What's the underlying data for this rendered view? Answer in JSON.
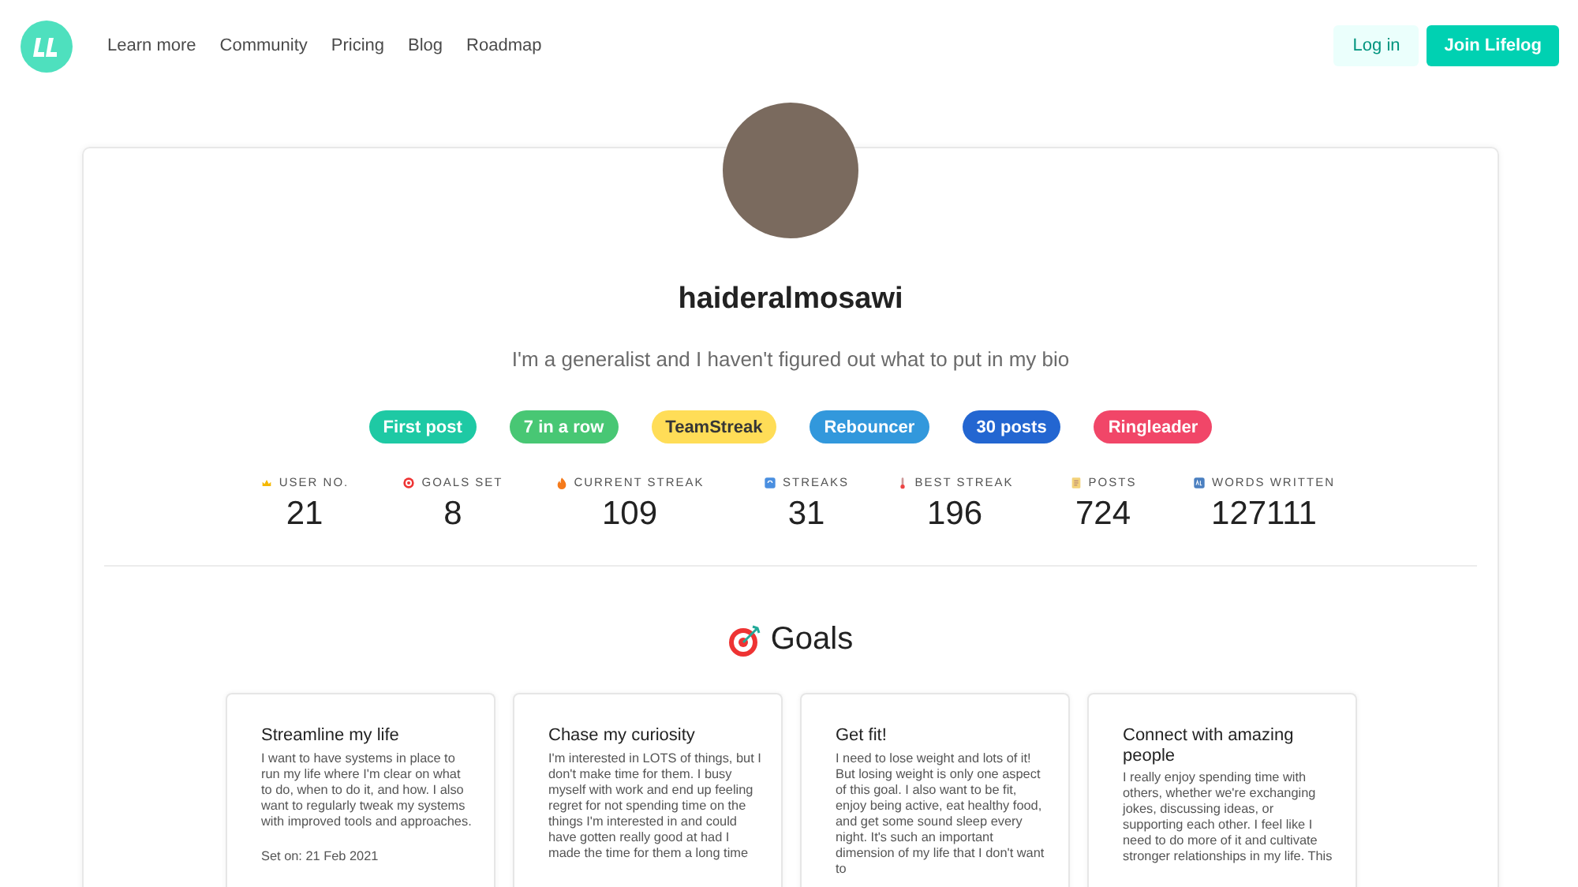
{
  "nav": {
    "links": [
      "Learn more",
      "Community",
      "Pricing",
      "Blog",
      "Roadmap"
    ],
    "login": "Log in",
    "join": "Join Lifelog"
  },
  "profile": {
    "username": "haideralmosawi",
    "bio": "I'm a generalist and I haven't figured out what to put in my bio",
    "badges": [
      {
        "label": "First post",
        "color": "#1ec9a4"
      },
      {
        "label": "7 in a row",
        "color": "#48c774"
      },
      {
        "label": "TeamStreak",
        "color": "#ffdd57"
      },
      {
        "label": "Rebouncer",
        "color": "#3298dc"
      },
      {
        "label": "30 posts",
        "color": "#2366d1"
      },
      {
        "label": "Ringleader",
        "color": "#f14668"
      }
    ],
    "stats": [
      {
        "label": "USER NO.",
        "value": "21"
      },
      {
        "label": "GOALS SET",
        "value": "8"
      },
      {
        "label": "CURRENT STREAK",
        "value": "109"
      },
      {
        "label": "STREAKS",
        "value": "31"
      },
      {
        "label": "BEST STREAK",
        "value": "196"
      },
      {
        "label": "POSTS",
        "value": "724"
      },
      {
        "label": "WORDS WRITTEN",
        "value": "127111"
      }
    ]
  },
  "goals": {
    "title": "Goals",
    "cards": [
      {
        "title": "Streamline my life",
        "description": "I want to have systems in place to run my life where I'm clear on what to do, when to do it, and how. I also want to regularly tweak my systems with improved tools and approaches.",
        "set_on": "Set on: 21 Feb 2021"
      },
      {
        "title": "Chase my curiosity",
        "description": "I'm interested in LOTS of things, but I don't make time for them. I busy myself with work and end up feeling regret for not spending time on the things I'm interested in and could have gotten really good at had I made the time for them a long time"
      },
      {
        "title": "Get fit!",
        "description": "I need to lose weight and lots of it! But losing weight is only one aspect of this goal. I also want to be fit, enjoy being active, eat healthy food, and get some sound sleep every night. It's such an important dimension of my life that I don't want to"
      },
      {
        "title": "Connect with amazing people",
        "description": "I really enjoy spending time with others, whether we're exchanging jokes, discussing ideas, or supporting each other. I feel like I need to do more of it and cultivate stronger relationships in my life. This"
      }
    ]
  }
}
